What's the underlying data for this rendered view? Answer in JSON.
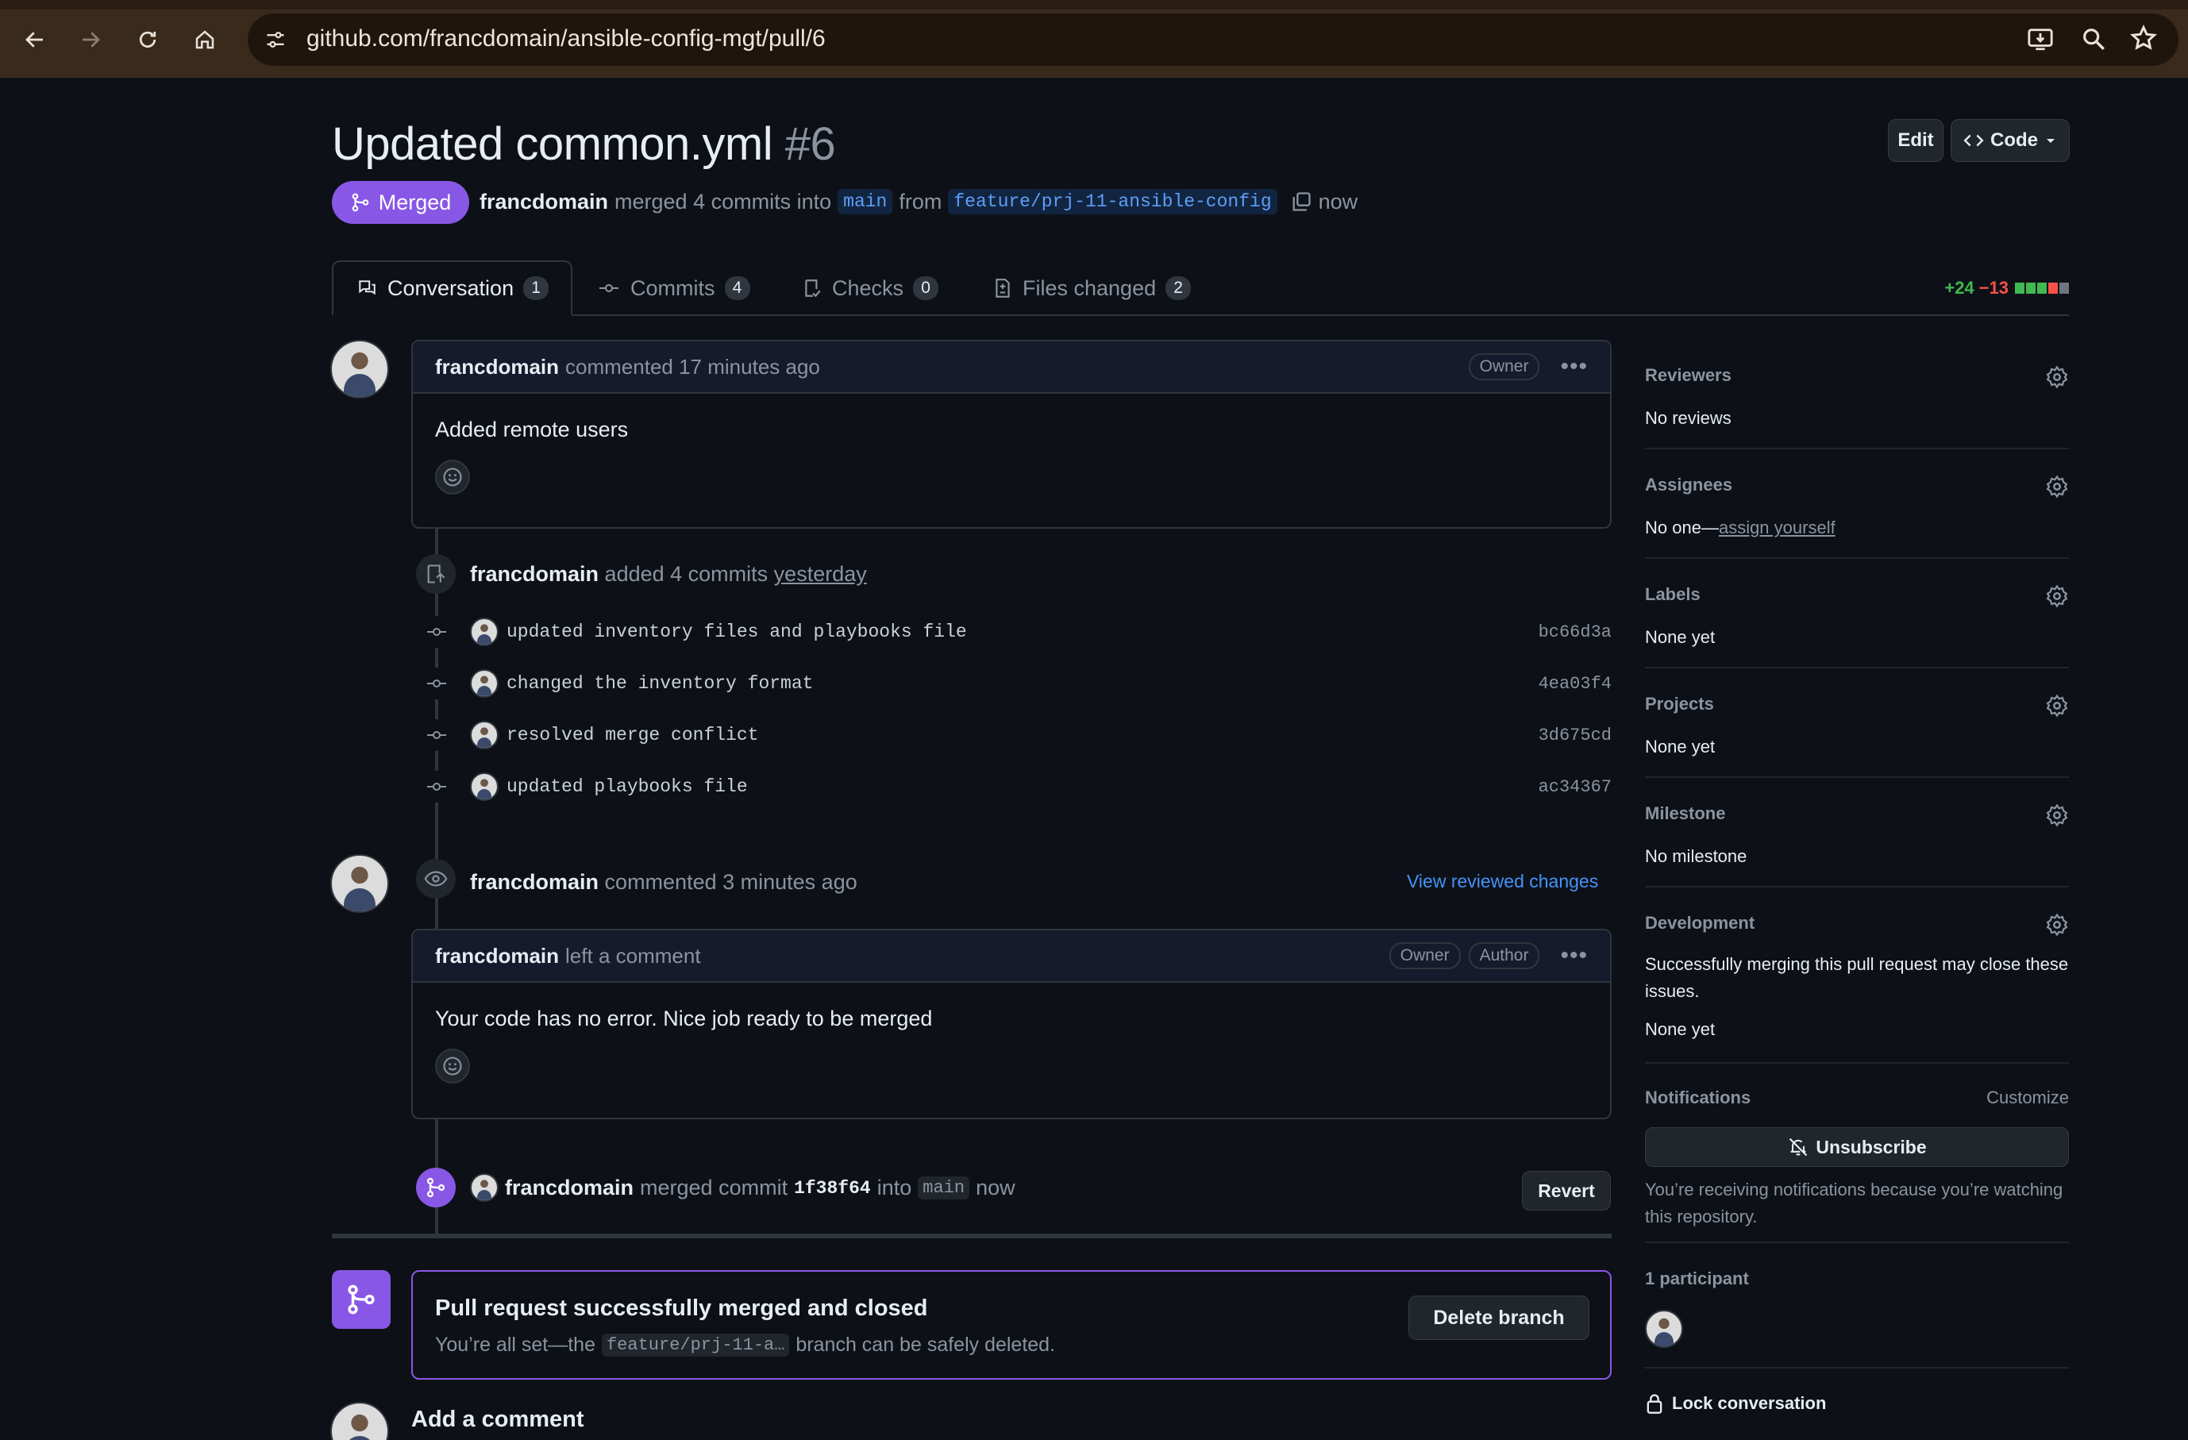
{
  "browser": {
    "url": "github.com/francdomain/ansible-config-mgt/pull/6"
  },
  "pr": {
    "title": "Updated common.yml",
    "number": "#6",
    "state": "Merged",
    "author": "francdomain",
    "meta_merged": "merged 4 commits into",
    "base_branch": "main",
    "meta_from": "from",
    "head_branch": "feature/prj-11-ansible-config",
    "time": "now",
    "edit_label": "Edit",
    "code_label": "Code"
  },
  "tabs": [
    {
      "label": "Conversation",
      "count": "1"
    },
    {
      "label": "Commits",
      "count": "4"
    },
    {
      "label": "Checks",
      "count": "0"
    },
    {
      "label": "Files changed",
      "count": "2"
    }
  ],
  "diffstat": {
    "additions": "+24",
    "deletions": "−13",
    "colors": {
      "add": "#3fb950",
      "del": "#f85149",
      "neutral": "#6e7681"
    }
  },
  "timeline": {
    "first_comment": {
      "author": "francdomain",
      "action": "commented 17 minutes ago",
      "badge": "Owner",
      "body": "Added remote users"
    },
    "commits_event": {
      "author": "francdomain",
      "action": "added 4 commits",
      "time": "yesterday",
      "commits": [
        {
          "message": "updated inventory files and playbooks file",
          "sha": "bc66d3a"
        },
        {
          "message": "changed the inventory format",
          "sha": "4ea03f4"
        },
        {
          "message": "resolved merge conflict",
          "sha": "3d675cd"
        },
        {
          "message": "updated playbooks file",
          "sha": "ac34367"
        }
      ]
    },
    "review": {
      "author": "francdomain",
      "action": "commented 3 minutes ago",
      "link": "View reviewed changes",
      "comment_author": "francdomain",
      "comment_action": "left a comment",
      "badges": [
        "Owner",
        "Author"
      ],
      "body": "Your code has no error. Nice job ready to be merged"
    },
    "merge_event": {
      "author": "francdomain",
      "action": "merged commit",
      "sha": "1f38f64",
      "into": "into",
      "branch": "main",
      "time": "now",
      "revert_label": "Revert"
    },
    "merged_box": {
      "title": "Pull request successfully merged and closed",
      "text_before": "You’re all set—the",
      "branch": "feature/prj-11-a…",
      "text_after": "branch can be safely deleted.",
      "delete_label": "Delete branch"
    },
    "add_comment": "Add a comment"
  },
  "sidebar": {
    "reviewers": {
      "title": "Reviewers",
      "value": "No reviews"
    },
    "assignees": {
      "title": "Assignees",
      "value_prefix": "No one—",
      "value_link": "assign yourself"
    },
    "labels": {
      "title": "Labels",
      "value": "None yet"
    },
    "projects": {
      "title": "Projects",
      "value": "None yet"
    },
    "milestone": {
      "title": "Milestone",
      "value": "No milestone"
    },
    "development": {
      "title": "Development",
      "desc": "Successfully merging this pull request may close these issues.",
      "value": "None yet"
    },
    "notifications": {
      "title": "Notifications",
      "customize": "Customize",
      "unsubscribe": "Unsubscribe",
      "desc": "You’re receiving notifications because you’re watching this repository."
    },
    "participants": {
      "title": "1 participant"
    },
    "lock": "Lock conversation"
  }
}
